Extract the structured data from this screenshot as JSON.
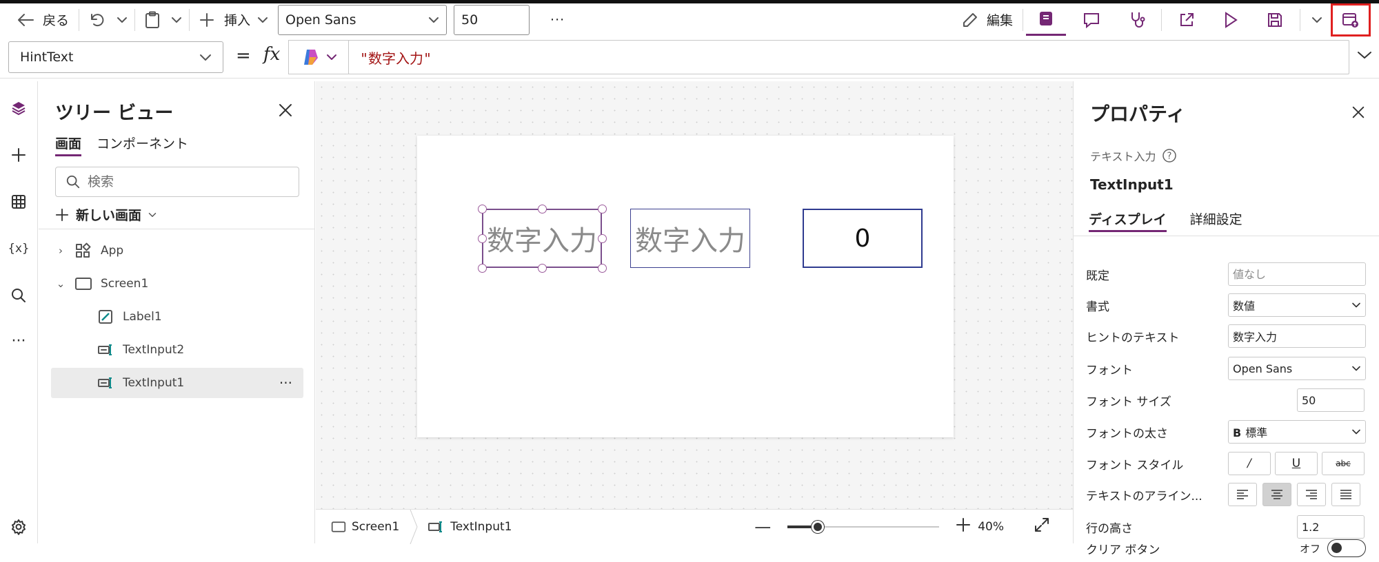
{
  "toolbar": {
    "back_label": "戻る",
    "insert_label": "挿入",
    "font_value": "Open Sans",
    "font_size_value": "50",
    "more_label": "···",
    "edit_label": "編集"
  },
  "formula_bar": {
    "property": "HintText",
    "equals": "=",
    "fx": "fx",
    "formula": "\"数字入力\""
  },
  "tree": {
    "title": "ツリー ビュー",
    "tabs": [
      "画面",
      "コンポーネント"
    ],
    "search_placeholder": "検索",
    "new_screen_label": "新しい画面",
    "nodes": [
      "App",
      "Screen1",
      "Label1",
      "TextInput2",
      "TextInput1"
    ],
    "more_label": "···"
  },
  "canvas": {
    "input1_hint": "数字入力",
    "input2_hint": "数字入力",
    "label_value": "0"
  },
  "statusbar": {
    "screen": "Screen1",
    "control": "TextInput1",
    "zoom": "40%",
    "zoom_fraction": 0.2
  },
  "properties": {
    "title": "プロパティ",
    "control_type": "テキスト入力",
    "control_name": "TextInput1",
    "tabs": [
      "ディスプレイ",
      "詳細設定"
    ],
    "default_label": "既定",
    "default_placeholder": "値なし",
    "format_label": "書式",
    "format_value": "数値",
    "hint_label": "ヒントのテキスト",
    "hint_value": "数字入力",
    "font_label": "フォント",
    "font_value": "Open Sans",
    "font_size_label": "フォント サイズ",
    "font_size_value": "50",
    "weight_label": "フォントの太さ",
    "weight_value": "標準",
    "style_label": "フォント スタイル",
    "align_label": "テキストのアライン...",
    "line_height_label": "行の高さ",
    "line_height_value": "1.2",
    "clear_label": "クリア ボタン",
    "clear_value": "オフ"
  },
  "colors": {
    "accent": "#742774",
    "highlight_border": "#e02020",
    "formula_text": "#a31515"
  }
}
